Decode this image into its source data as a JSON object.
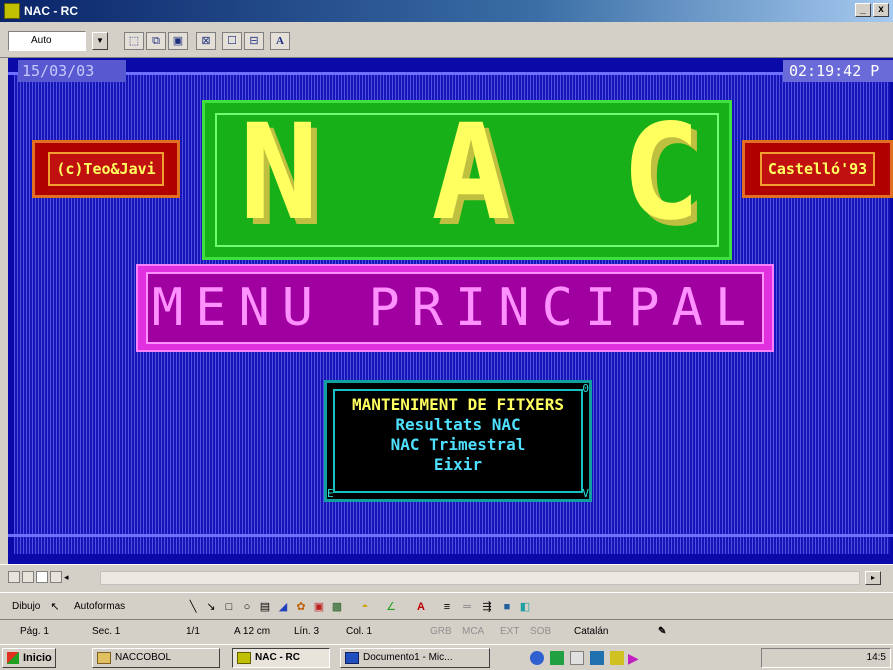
{
  "window": {
    "title": "NAC - RC",
    "minimize_glyph": "_",
    "close_glyph": "x"
  },
  "dos_toolbar": {
    "font_select_value": "Auto",
    "font_button_label": "A"
  },
  "dos_screen": {
    "date": "15/03/03",
    "time": "02:19:42 P",
    "left_credit": "(c)Teo&Javi",
    "right_credit": "Castelló'93",
    "logo_letters": [
      "N",
      "A",
      "C"
    ],
    "menu_title": "MENU PRINCIPAL",
    "menu_options": [
      {
        "label": "MANTENIMENT DE FITXERS",
        "selected": true
      },
      {
        "label": "Resultats NAC",
        "selected": false
      },
      {
        "label": "NAC Trimestral",
        "selected": false
      },
      {
        "label": "Eixir",
        "selected": false
      }
    ],
    "corner_marks": {
      "top_right": "0",
      "bottom_left": "E",
      "bottom_right": "V"
    },
    "colors": {
      "background": "#0a0aa8",
      "logo_box": "#18b018",
      "menu_banner": "#e030e0",
      "highlight": "#ffff60"
    }
  },
  "drawing_toolbar": {
    "draw_label": "Dibujo",
    "autoshapes_label": "Autoformas"
  },
  "status_bar": {
    "page": "Pág. 1",
    "section": "Sec. 1",
    "pages": "1/1",
    "at": "A 12 cm",
    "line": "Lín. 3",
    "column": "Col. 1",
    "grb": "GRB",
    "mca": "MCA",
    "ext": "EXT",
    "sob": "SOB",
    "language": "Catalán"
  },
  "taskbar": {
    "start_label": "Inicio",
    "tasks": [
      {
        "label": "NACCOBOL",
        "pressed": false
      },
      {
        "label": "NAC - RC",
        "pressed": true
      },
      {
        "label": "Documento1 - Mic...",
        "pressed": false
      }
    ],
    "clock": "14:5"
  }
}
